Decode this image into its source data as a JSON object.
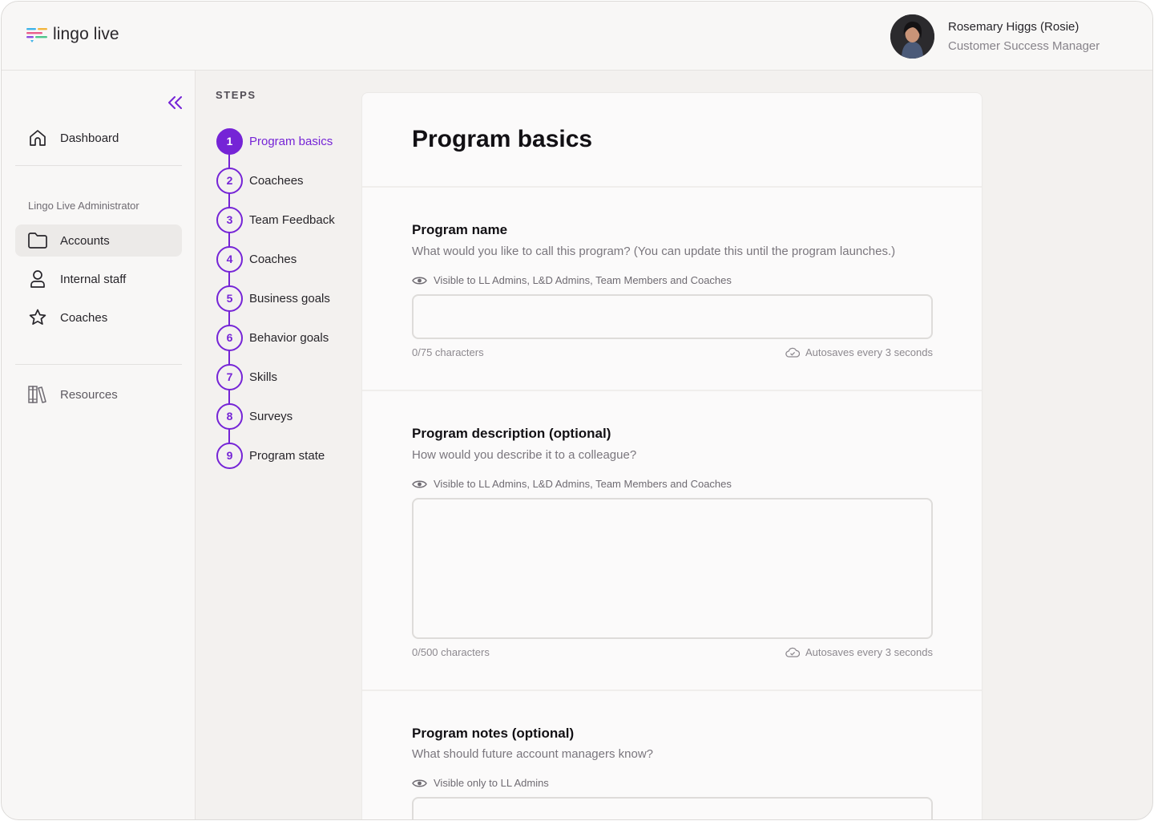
{
  "app": {
    "logo_text": "lingo live"
  },
  "user": {
    "name": "Rosemary Higgs (Rosie)",
    "role": "Customer Success Manager"
  },
  "sidebar": {
    "items": [
      {
        "label": "Dashboard",
        "icon": "home-icon"
      },
      {
        "label": "Accounts",
        "icon": "folder-icon",
        "active": true
      },
      {
        "label": "Internal staff",
        "icon": "person-icon"
      },
      {
        "label": "Coaches",
        "icon": "star-icon"
      },
      {
        "label": "Resources",
        "icon": "books-icon"
      }
    ],
    "section_label": "Lingo Live Administrator"
  },
  "steps": {
    "title": "STEPS",
    "items": [
      {
        "number": "1",
        "label": "Program basics",
        "active": true
      },
      {
        "number": "2",
        "label": "Coachees"
      },
      {
        "number": "3",
        "label": "Team Feedback"
      },
      {
        "number": "4",
        "label": "Coaches"
      },
      {
        "number": "5",
        "label": "Business goals"
      },
      {
        "number": "6",
        "label": "Behavior goals"
      },
      {
        "number": "7",
        "label": "Skills"
      },
      {
        "number": "8",
        "label": "Surveys"
      },
      {
        "number": "9",
        "label": "Program state"
      }
    ]
  },
  "main": {
    "title": "Program basics",
    "fields": [
      {
        "title": "Program name",
        "help": "What would you like to call this program? (You can update this until the program launches.)",
        "visibility": "Visible to LL Admins, L&D Admins, Team Members and Coaches",
        "value": "",
        "counter": "0/75 characters",
        "autosave": "Autosaves every 3 seconds"
      },
      {
        "title": "Program description (optional)",
        "help": "How would you describe it to a colleague?",
        "visibility": "Visible to LL Admins, L&D Admins, Team Members and Coaches",
        "value": "",
        "counter": "0/500 characters",
        "autosave": "Autosaves every 3 seconds"
      },
      {
        "title": "Program notes (optional)",
        "help": "What should future account managers know?",
        "visibility": "Visible only to LL Admins",
        "value": ""
      }
    ]
  },
  "colors": {
    "accent": "#7524d6",
    "background": "#f3f1ef",
    "panel": "#f8f7f6"
  }
}
